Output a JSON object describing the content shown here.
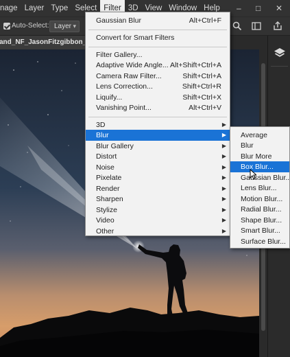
{
  "menubar": {
    "items": [
      "nage",
      "Layer",
      "Type",
      "Select",
      "Filter",
      "3D",
      "View",
      "Window",
      "Help"
    ],
    "active": "Filter",
    "window_controls": [
      "–",
      "□",
      "✕"
    ]
  },
  "options_bar": {
    "auto_select_label": "Auto-Select:",
    "auto_select_checked": true,
    "target_value": "Layer",
    "icons": [
      "search-icon",
      "workspace-icon",
      "share-icon"
    ]
  },
  "document_tab": {
    "title": "and_NF_JasonFitzgibbon_.png"
  },
  "filter_menu": {
    "items": [
      {
        "label": "Gaussian Blur",
        "shortcut": "Alt+Ctrl+F"
      },
      {
        "label": "Convert for Smart Filters",
        "shortcut": ""
      },
      {
        "label": "Filter Gallery...",
        "shortcut": ""
      },
      {
        "label": "Adaptive Wide Angle...",
        "shortcut": "Alt+Shift+Ctrl+A"
      },
      {
        "label": "Camera Raw Filter...",
        "shortcut": "Shift+Ctrl+A"
      },
      {
        "label": "Lens Correction...",
        "shortcut": "Shift+Ctrl+R"
      },
      {
        "label": "Liquify...",
        "shortcut": "Shift+Ctrl+X"
      },
      {
        "label": "Vanishing Point...",
        "shortcut": "Alt+Ctrl+V"
      },
      {
        "label": "3D",
        "shortcut": ""
      },
      {
        "label": "Blur",
        "shortcut": ""
      },
      {
        "label": "Blur Gallery",
        "shortcut": ""
      },
      {
        "label": "Distort",
        "shortcut": ""
      },
      {
        "label": "Noise",
        "shortcut": ""
      },
      {
        "label": "Pixelate",
        "shortcut": ""
      },
      {
        "label": "Render",
        "shortcut": ""
      },
      {
        "label": "Sharpen",
        "shortcut": ""
      },
      {
        "label": "Stylize",
        "shortcut": ""
      },
      {
        "label": "Video",
        "shortcut": ""
      },
      {
        "label": "Other",
        "shortcut": ""
      }
    ],
    "highlighted": "Blur"
  },
  "blur_submenu": {
    "items": [
      "Average",
      "Blur",
      "Blur More",
      "Box Blur...",
      "Gaussian Blur...",
      "Lens Blur...",
      "Motion Blur...",
      "Radial Blur...",
      "Shape Blur...",
      "Smart Blur...",
      "Surface Blur..."
    ],
    "highlighted": "Box Blur..."
  },
  "colors": {
    "highlight": "#1a73d6",
    "menubar_bg": "#323232",
    "menu_bg": "#f2f2f2"
  }
}
